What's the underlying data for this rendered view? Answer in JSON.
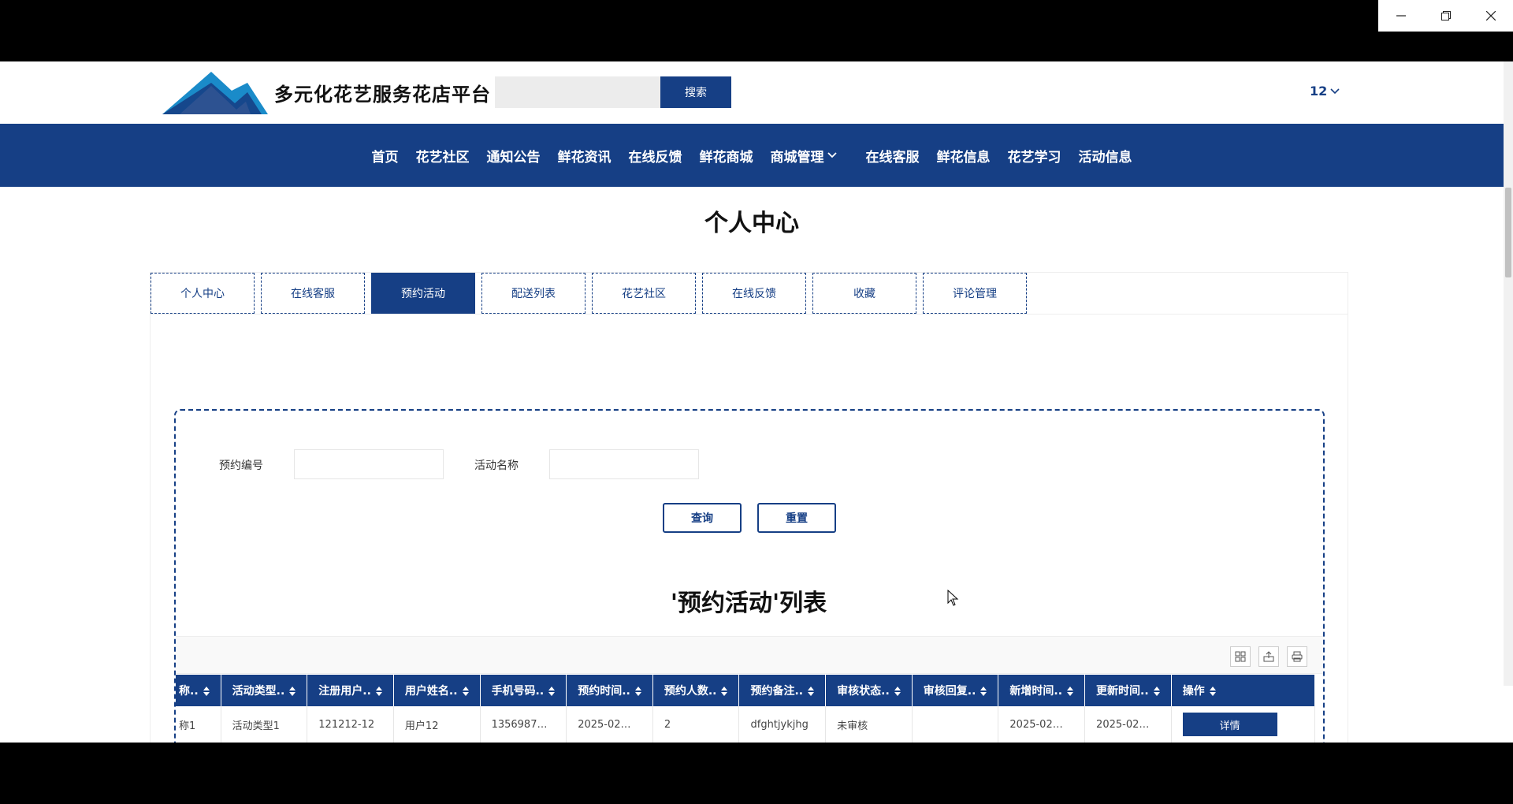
{
  "header": {
    "site_title": "多元化花艺服务花店平台",
    "search_placeholder": "",
    "search_button": "搜索",
    "user": "12"
  },
  "nav": {
    "items": [
      {
        "label": "首页"
      },
      {
        "label": "花艺社区"
      },
      {
        "label": "通知公告"
      },
      {
        "label": "鲜花资讯"
      },
      {
        "label": "在线反馈"
      },
      {
        "label": "鲜花商城"
      },
      {
        "label": "商城管理"
      },
      {
        "label": "在线客服"
      },
      {
        "label": "鲜花信息"
      },
      {
        "label": "花艺学习"
      },
      {
        "label": "活动信息"
      }
    ]
  },
  "page_title": "个人中心",
  "tabs": [
    {
      "label": "个人中心"
    },
    {
      "label": "在线客服"
    },
    {
      "label": "预约活动"
    },
    {
      "label": "配送列表"
    },
    {
      "label": "花艺社区"
    },
    {
      "label": "在线反馈"
    },
    {
      "label": "收藏"
    },
    {
      "label": "评论管理"
    }
  ],
  "active_tab": "预约活动",
  "form": {
    "field1_label": "预约编号",
    "field1_value": "",
    "field2_label": "活动名称",
    "field2_value": "",
    "query_button": "查询",
    "reset_button": "重置"
  },
  "list_title": "'预约活动'列表",
  "table": {
    "headers": [
      "称..",
      "活动类型..",
      "注册用户..",
      "用户姓名..",
      "手机号码..",
      "预约时间..",
      "预约人数..",
      "预约备注..",
      "审核状态..",
      "审核回复..",
      "新增时间..",
      "更新时间..",
      "操作"
    ],
    "rows": [
      [
        "称1",
        "活动类型1",
        "121212-12",
        "用户12",
        "1356987…",
        "2025-02…",
        "2",
        "dfghtjykjhg",
        "未审核",
        "",
        "2025-02…",
        "2025-02…",
        "详情"
      ]
    ]
  },
  "colors": {
    "primary": "#163f85"
  }
}
